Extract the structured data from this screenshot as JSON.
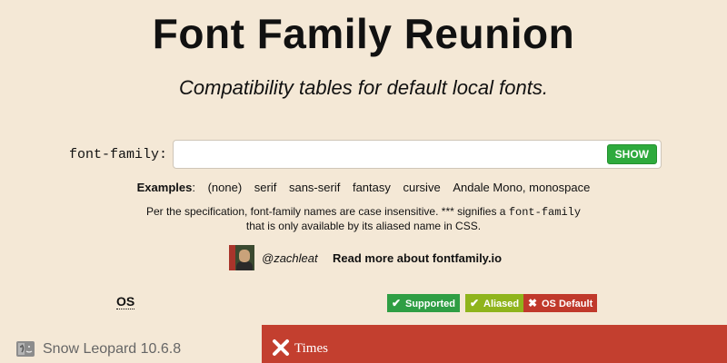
{
  "header": {
    "title": "Font Family Reunion",
    "subtitle": "Compatibility tables for default local fonts."
  },
  "search": {
    "label": "font-family:",
    "value": "",
    "placeholder": "",
    "show_label": "SHOW"
  },
  "examples": {
    "label": "Examples",
    "items": [
      "(none)",
      "serif",
      "sans-serif",
      "fantasy",
      "cursive",
      "Andale Mono, monospace"
    ]
  },
  "spec": {
    "text_before": "Per the specification, font-family names are case insensitive. *** signifies a",
    "code": "font-family",
    "text_after": "that is only available by its aliased name in CSS."
  },
  "author": {
    "handle": "@zachleat",
    "readmore": "Read more about fontfamily.io"
  },
  "table": {
    "os_header": "OS",
    "legend": {
      "supported": "Supported",
      "aliased": "Aliased",
      "os_default": "OS Default"
    },
    "rows": [
      {
        "os": "Snow Leopard 10.6.8",
        "result": "Times",
        "status": "os-default"
      }
    ]
  },
  "colors": {
    "background": "#f4e8d6",
    "supported": "#2f9e44",
    "aliased": "#8fb41c",
    "os_default": "#c0392b",
    "show_button": "#2eaa3d"
  }
}
